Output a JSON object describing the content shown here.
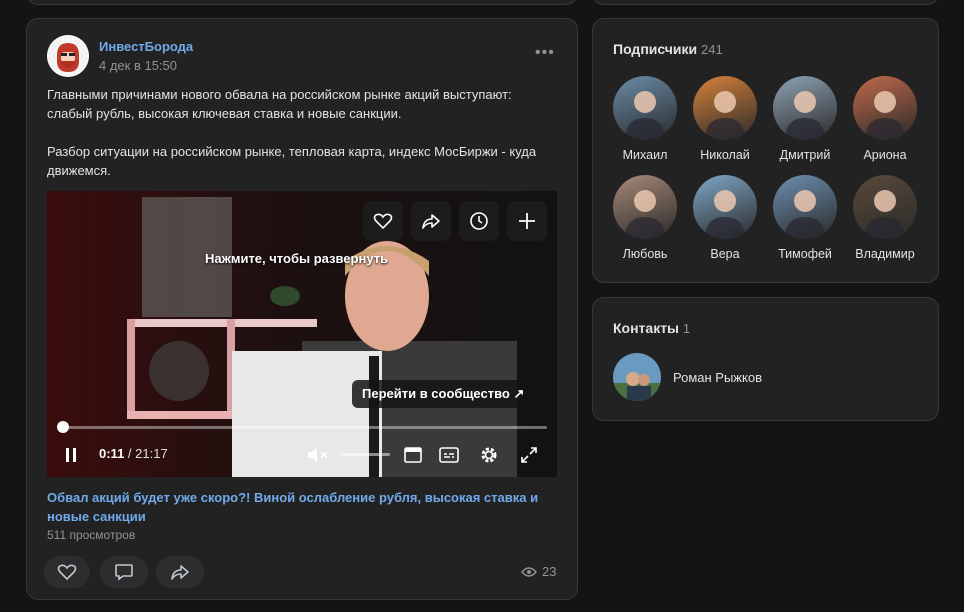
{
  "post": {
    "author": "ИнвестБорода",
    "date": "4 дек в 15:50",
    "text_p1": "Главными причинами нового обвала на российском рынке акций выступают: слабый рубль, высокая ключевая ставка и новые санкции.",
    "text_p2": "Разбор ситуации на российском рынке, тепловая карта, индекс МосБиржи - куда движемся.",
    "video": {
      "hint": "Нажмите, чтобы развернуть",
      "goto": "Перейти в сообщество ↗",
      "time_current": "0:11",
      "time_sep": " / ",
      "time_total": "21:17",
      "progress": 0.009
    },
    "video_title": "Обвал акций будет уже скоро?! Виной ослабление рубля, высокая ставка и новые санкции",
    "views_text": "511 просмотров",
    "view_count": "23"
  },
  "subscribers": {
    "title": "Подписчики",
    "count": "241",
    "items": [
      {
        "name": "Михаил",
        "color": "#6a8ca8"
      },
      {
        "name": "Николай",
        "color": "#d8823a"
      },
      {
        "name": "Дмитрий",
        "color": "#8fa3b5"
      },
      {
        "name": "Ариона",
        "color": "#c26a4a"
      },
      {
        "name": "Любовь",
        "color": "#a88a78"
      },
      {
        "name": "Вера",
        "color": "#7fa7c8"
      },
      {
        "name": "Тимофей",
        "color": "#6d8fb0"
      },
      {
        "name": "Владимир",
        "color": "#5a4a3a"
      }
    ]
  },
  "contacts": {
    "title": "Контакты",
    "count": "1",
    "name": "Роман Рыжков"
  }
}
